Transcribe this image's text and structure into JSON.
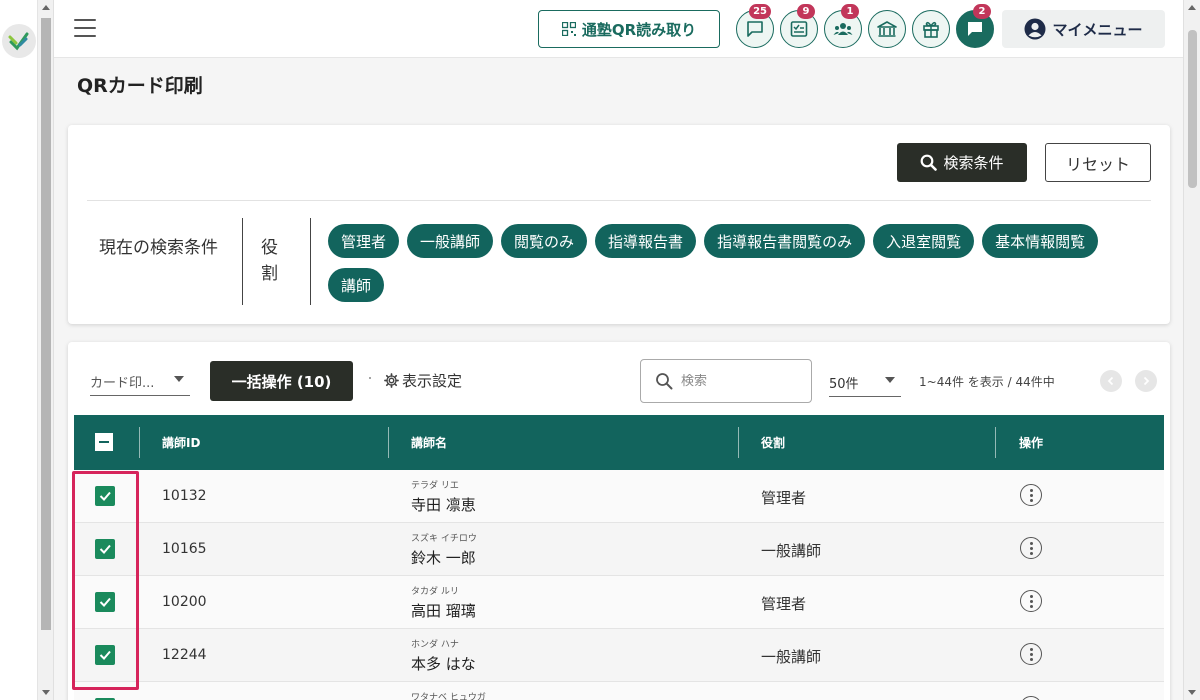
{
  "header": {
    "qr_button_label": "通塾QR読み取り",
    "icon_buttons": [
      {
        "icon": "chat-bubble-icon",
        "badge": "25"
      },
      {
        "icon": "checklist-icon",
        "badge": "9"
      },
      {
        "icon": "group-icon",
        "badge": "1"
      },
      {
        "icon": "school-building-icon",
        "badge": ""
      },
      {
        "icon": "gift-icon",
        "badge": ""
      },
      {
        "icon": "message-icon",
        "badge": "2"
      }
    ],
    "my_menu_label": "マイメニュー"
  },
  "page_title": "QRカード印刷",
  "filter": {
    "search_button_label": "検索条件",
    "reset_button_label": "リセット",
    "current_label": "現在の検索条件",
    "role_label": "役割",
    "chips": [
      "管理者",
      "一般講師",
      "閲覧のみ",
      "指導報告書",
      "指導報告書閲覧のみ",
      "入退室閲覧",
      "基本情報閲覧",
      "講師"
    ]
  },
  "toolbar": {
    "select_value": "カード印...",
    "bulk_label": "一括操作 (10)",
    "display_settings_label": "表示設定",
    "search_placeholder": "検索",
    "per_page": "50件",
    "range_text": "1~44件 を表示 / 44件中"
  },
  "table": {
    "headers": {
      "id": "講師ID",
      "name": "講師名",
      "role": "役割",
      "ops": "操作"
    },
    "rows": [
      {
        "id": "10132",
        "kana": "テラダ リエ",
        "name": "寺田 凛恵",
        "role": "管理者",
        "checked": true
      },
      {
        "id": "10165",
        "kana": "スズキ イチロウ",
        "name": "鈴木 一郎",
        "role": "一般講師",
        "checked": true
      },
      {
        "id": "10200",
        "kana": "タカダ ルリ",
        "name": "高田 瑠璃",
        "role": "管理者",
        "checked": true
      },
      {
        "id": "12244",
        "kana": "ホンダ ハナ",
        "name": "本多 はな",
        "role": "一般講師",
        "checked": true
      },
      {
        "id": "",
        "kana": "ワタナベ ヒュウガ",
        "name": "",
        "role": "",
        "checked": true
      }
    ]
  },
  "colors": {
    "primary": "#12645d",
    "dark_button": "#2a2e28",
    "badge": "#c2365a",
    "checkbox": "#1a8a5c",
    "highlight": "#d6245b"
  }
}
